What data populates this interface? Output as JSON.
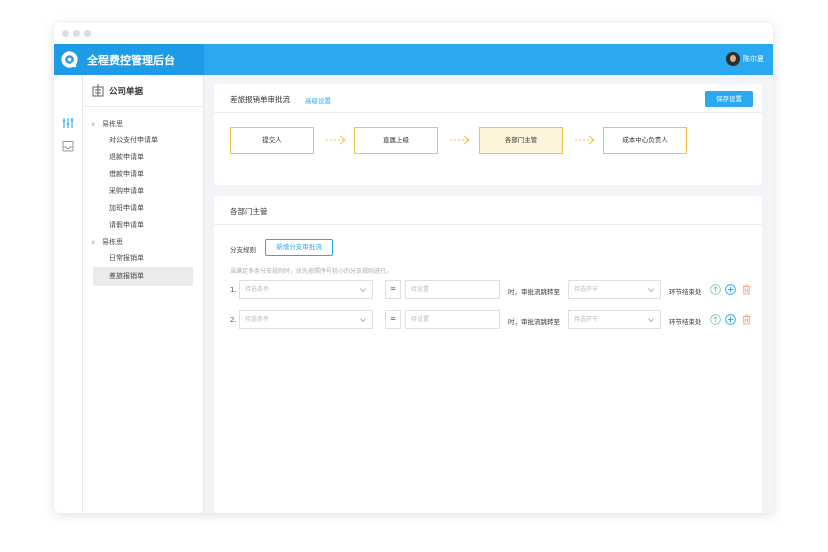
{
  "app": {
    "title": "全程费控管理后台",
    "user": "陈尔夏"
  },
  "tree": {
    "header": "公司单据",
    "groups": [
      {
        "label": "易栋思",
        "items": [
          "对公支付申请单",
          "退款申请单",
          "借款申请单",
          "采购申请单",
          "加班申请单",
          "请假申请单"
        ]
      },
      {
        "label": "易栋思",
        "items": [
          "日常报销单",
          "差旅报销单"
        ]
      }
    ],
    "active_item": "差旅报销单"
  },
  "flow_card": {
    "title": "差旅报销单审批流",
    "link": "高级设置",
    "save": "保存设置",
    "nodes": [
      "提交人",
      "直属上级",
      "各部门主管",
      "成本中心负责人"
    ],
    "active_node": "各部门主管"
  },
  "rule_card": {
    "title": "各部门主管",
    "branch_label": "分支规则",
    "add_button": "新增分支审批流",
    "hint": "当满足多条分支规则时，优先按照序号较小的分支规则进行。",
    "rows": [
      {
        "num": "1.",
        "condition_placeholder": "待选条件",
        "operator": "=",
        "value_placeholder": "待设置",
        "mid_text": "时，审批流跳转至",
        "step_placeholder": "待选环节",
        "end_text": "环节结束处"
      },
      {
        "num": "2.",
        "condition_placeholder": "待选条件",
        "operator": "=",
        "value_placeholder": "待设置",
        "mid_text": "时，审批流跳转至",
        "step_placeholder": "待选环节",
        "end_text": "环节结束处"
      }
    ]
  },
  "colors": {
    "primary": "#2aa8f0",
    "node_border": "#f0c24a",
    "node_active_bg": "#fdf4d9",
    "delete": "#f39c7a",
    "up": "#7fd3a3"
  }
}
